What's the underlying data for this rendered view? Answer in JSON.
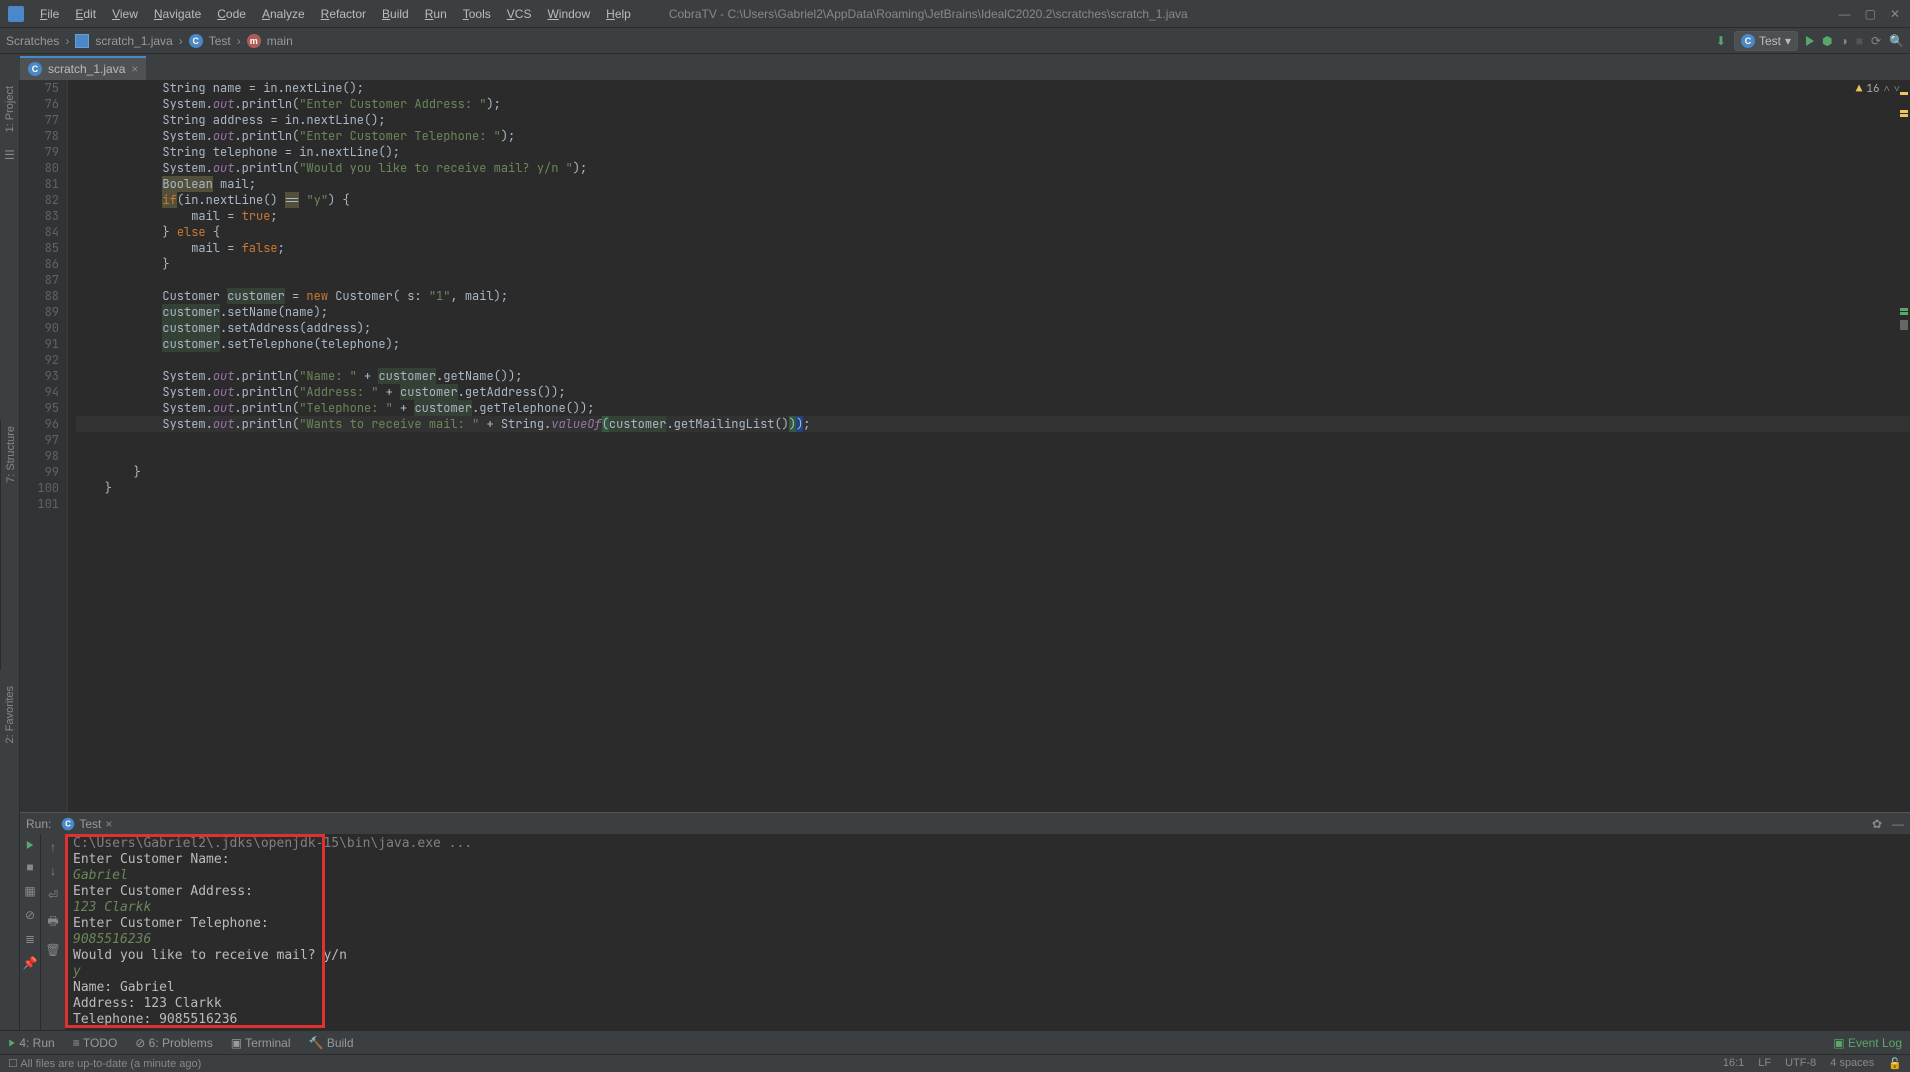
{
  "menu": [
    "File",
    "Edit",
    "View",
    "Navigate",
    "Code",
    "Analyze",
    "Refactor",
    "Build",
    "Run",
    "Tools",
    "VCS",
    "Window",
    "Help"
  ],
  "title": "CobraTV - C:\\Users\\Gabriel2\\AppData\\Roaming\\JetBrains\\IdealC2020.2\\scratches\\scratch_1.java",
  "breadcrumbs": {
    "a": "Scratches",
    "b": "scratch_1.java",
    "c": "Test",
    "d": "main"
  },
  "runConfig": "Test",
  "tab": "scratch_1.java",
  "warnings": "16",
  "sidebarTools": {
    "project": "1: Project",
    "structure": "7: Structure",
    "fav": "2: Favorites"
  },
  "code": {
    "startLine": 75,
    "lines": [
      {
        "n": 75,
        "html": "            String name = in.nextLine();"
      },
      {
        "n": 76,
        "html": "            System.<span class='fld'>out</span>.println(<span class='str'>\"Enter Customer Address: \"</span>);"
      },
      {
        "n": 77,
        "html": "            String address = in.nextLine();"
      },
      {
        "n": 78,
        "html": "            System.<span class='fld'>out</span>.println(<span class='str'>\"Enter Customer Telephone: \"</span>);"
      },
      {
        "n": 79,
        "html": "            String telephone = in.nextLine();"
      },
      {
        "n": 80,
        "html": "            System.<span class='fld'>out</span>.println(<span class='str'>\"Would you like to receive mail? y/n \"</span>);"
      },
      {
        "n": 81,
        "html": "            <span class='warn'>Boolean</span> mail;"
      },
      {
        "n": 82,
        "html": "            <span class='kw warn'>if</span>(in.nextLine() <span class='warn'>==</span> <span class='str'>\"y\"</span>) {"
      },
      {
        "n": 83,
        "html": "                mail = <span class='kw'>true</span>;"
      },
      {
        "n": 84,
        "html": "            } <span class='kw'>else</span> {"
      },
      {
        "n": 85,
        "html": "                mail = <span class='kw'>false</span>;"
      },
      {
        "n": 86,
        "html": "            }"
      },
      {
        "n": 87,
        "html": ""
      },
      {
        "n": 88,
        "html": "            Customer <span class='bghl'>customer</span> = <span class='kw'>new</span> Customer( s: <span class='str'>\"1\"</span>, mail);"
      },
      {
        "n": 89,
        "html": "            <span class='bghl'>customer</span>.setName(name);"
      },
      {
        "n": 90,
        "html": "            <span class='bghl'>customer</span>.setAddress(address);"
      },
      {
        "n": 91,
        "html": "            <span class='bghl'>customer</span>.setTelephone(telephone);"
      },
      {
        "n": 92,
        "html": ""
      },
      {
        "n": 93,
        "html": "            System.<span class='fld'>out</span>.println(<span class='str'>\"Name: \"</span> + <span class='bghl'>customer</span>.getName());"
      },
      {
        "n": 94,
        "html": "            System.<span class='fld'>out</span>.println(<span class='str'>\"Address: \"</span> + <span class='bghl'>customer</span>.getAddress());"
      },
      {
        "n": 95,
        "html": "            System.<span class='fld'>out</span>.println(<span class='str'>\"Telephone: \"</span> + <span class='bghl'>customer</span>.getTelephone());"
      },
      {
        "n": 96,
        "html": "            System.<span class='fld'>out</span>.println(<span class='str'>\"Wants to receive mail: \"</span> + String.<span class='fld'>valueOf</span><span class='hl'>(</span><span class='bghl'>customer</span>.getMailingList()<span class='hl'>)</span><span class='cur'>)</span>;",
        "active": true
      },
      {
        "n": 97,
        "html": ""
      },
      {
        "n": 98,
        "html": ""
      },
      {
        "n": 99,
        "html": "        }"
      },
      {
        "n": 100,
        "html": "    }"
      },
      {
        "n": 101,
        "html": ""
      }
    ]
  },
  "run": {
    "label": "Run:",
    "tab": "Test",
    "lines": [
      {
        "t": "C:\\Users\\Gabriel2\\.jdks\\openjdk-15\\bin\\java.exe ...",
        "cls": "dim"
      },
      {
        "t": "Enter Customer Name: ",
        "cls": ""
      },
      {
        "t": "Gabriel",
        "cls": "in"
      },
      {
        "t": "Enter Customer Address: ",
        "cls": ""
      },
      {
        "t": "123 Clarkk",
        "cls": "in"
      },
      {
        "t": "Enter Customer Telephone: ",
        "cls": ""
      },
      {
        "t": "9085516236",
        "cls": "in"
      },
      {
        "t": "Would you like to receive mail? y/n ",
        "cls": ""
      },
      {
        "t": "y",
        "cls": "in"
      },
      {
        "t": "Name: Gabriel",
        "cls": ""
      },
      {
        "t": "Address: 123 Clarkk",
        "cls": ""
      },
      {
        "t": "Telephone: 9085516236",
        "cls": ""
      }
    ]
  },
  "bottomTools": {
    "run": "4: Run",
    "todo": "TODO",
    "problems": "6: Problems",
    "terminal": "Terminal",
    "build": "Build",
    "event": "Event Log"
  },
  "status": {
    "msg": "All files are up-to-date (a minute ago)",
    "pos": "16:1",
    "lf": "LF",
    "enc": "UTF-8",
    "ind": "4 spaces"
  }
}
